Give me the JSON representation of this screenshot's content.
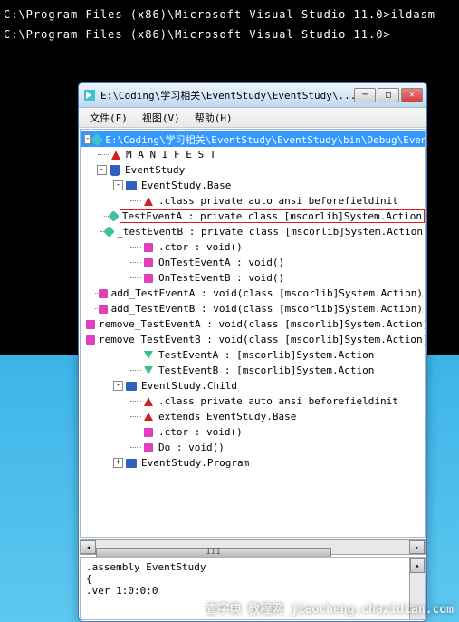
{
  "console": {
    "line1": "C:\\Program Files (x86)\\Microsoft Visual Studio 11.0>ildasm",
    "line2": "C:\\Program Files (x86)\\Microsoft Visual Studio 11.0>"
  },
  "window": {
    "title": "E:\\Coding\\学习相关\\EventStudy\\EventStudy\\..."
  },
  "menu": {
    "file": "文件(F)",
    "view": "视图(V)",
    "help": "帮助(H)"
  },
  "tree": {
    "root": "E:\\Coding\\学习相关\\EventStudy\\EventStudy\\bin\\Debug\\EventStudy.e",
    "manifest": "M A N I F E S T",
    "ns": "EventStudy",
    "base": {
      "name": "EventStudy.Base",
      "class_attrs": ".class private auto ansi beforefieldinit",
      "TestEventA": "TestEventA : private class [mscorlib]System.Action",
      "_testEventB": "_testEventB : private class [mscorlib]System.Action",
      "ctor": ".ctor : void()",
      "OnTestEventA": "OnTestEventA : void()",
      "OnTestEventB": "OnTestEventB : void()",
      "add_TestEventA": "add_TestEventA : void(class [mscorlib]System.Action)",
      "add_TestEventB": "add_TestEventB : void(class [mscorlib]System.Action)",
      "remove_TestEventA": "remove_TestEventA : void(class [mscorlib]System.Action)",
      "remove_TestEventB": "remove_TestEventB : void(class [mscorlib]System.Action)",
      "evt_TestEventA": "TestEventA : [mscorlib]System.Action",
      "evt_TestEventB": "TestEventB : [mscorlib]System.Action"
    },
    "child": {
      "name": "EventStudy.Child",
      "class_attrs": ".class private auto ansi beforefieldinit",
      "extends": "extends EventStudy.Base",
      "ctor": ".ctor : void()",
      "Do": "Do : void()"
    },
    "program": "EventStudy.Program"
  },
  "bottom": {
    "line1": ".assembly EventStudy",
    "line2": "{",
    "line3": "  .ver 1:0:0:0"
  },
  "watermark": "查字典 教程网\njiaocheng.chazidian.com",
  "scroll_marker": "III"
}
